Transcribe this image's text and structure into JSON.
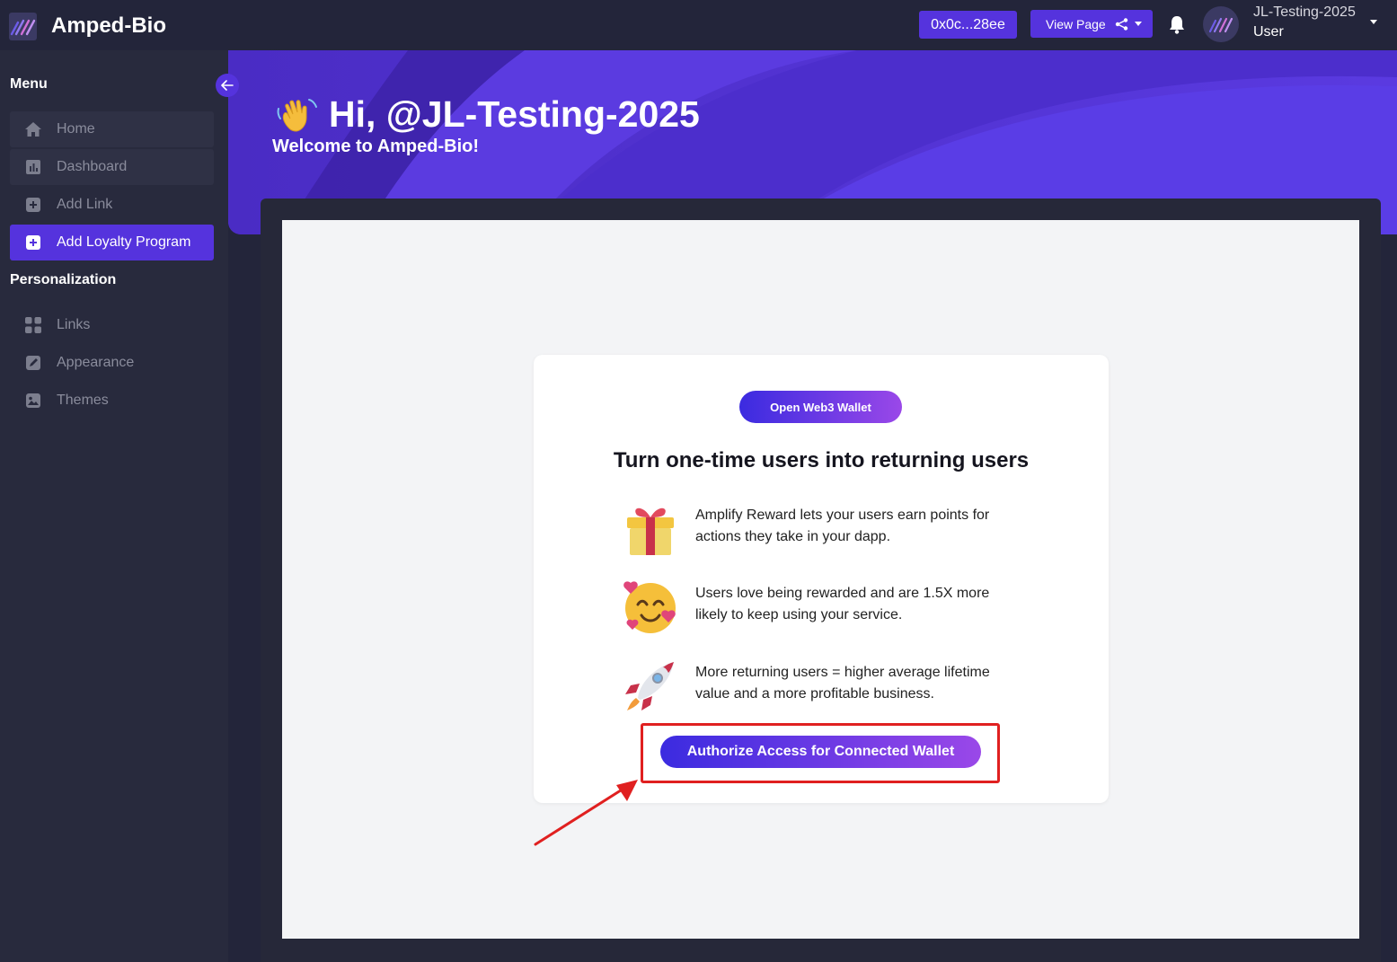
{
  "app": {
    "title": "Amped-Bio"
  },
  "header": {
    "wallet_address": "0x0c...28ee",
    "view_page_label": "View Page",
    "user_name": "JL-Testing-2025",
    "user_role": "User",
    "icons": [
      "logo-icon",
      "share-icon",
      "caret-down-icon",
      "bell-icon",
      "avatar"
    ]
  },
  "sidebar": {
    "menu_title": "Menu",
    "personalization_title": "Personalization",
    "menu_items": [
      {
        "label": "Home",
        "icon": "home-icon"
      },
      {
        "label": "Dashboard",
        "icon": "chart-icon"
      },
      {
        "label": "Add Link",
        "icon": "plus-square-icon"
      },
      {
        "label": "Add Loyalty Program",
        "icon": "plus-square-icon",
        "active": true
      }
    ],
    "personalization_items": [
      {
        "label": "Links",
        "icon": "grid-icon"
      },
      {
        "label": "Appearance",
        "icon": "brush-icon"
      },
      {
        "label": "Themes",
        "icon": "image-icon"
      }
    ]
  },
  "banner": {
    "greeting": "Hi, @JL-Testing-2025",
    "welcome": "Welcome to Amped-Bio!"
  },
  "card": {
    "open_wallet_label": "Open Web3 Wallet",
    "heading": "Turn one-time users into returning users",
    "features": [
      {
        "icon": "gift-icon",
        "line1": "Amplify Reward lets your users earn points for",
        "line2": "actions they take in your dapp."
      },
      {
        "icon": "smiling-hearts-icon",
        "line1": "Users love being rewarded and are 1.5X more",
        "line2": "likely to keep using your service."
      },
      {
        "icon": "rocket-icon",
        "line1": "More returning users = higher average lifetime",
        "line2": "value and a more profitable business."
      }
    ],
    "authorize_label": "Authorize Access for Connected Wallet"
  },
  "colors": {
    "accent": "#5533dd",
    "bg_dark": "#23253a",
    "sidebar": "#282a3d",
    "highlight": "#e02020",
    "gradient_start": "#3b2be0",
    "gradient_end": "#9a48e8"
  }
}
